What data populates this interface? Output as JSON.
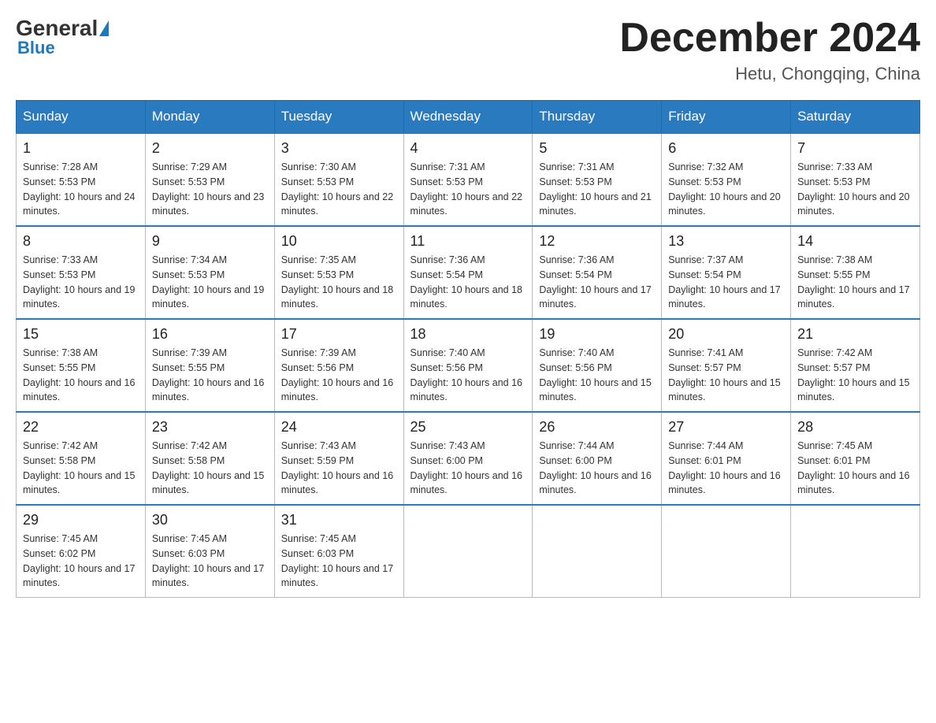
{
  "header": {
    "logo": {
      "general": "General",
      "blue": "Blue"
    },
    "title": "December 2024",
    "location": "Hetu, Chongqing, China"
  },
  "days_of_week": [
    "Sunday",
    "Monday",
    "Tuesday",
    "Wednesday",
    "Thursday",
    "Friday",
    "Saturday"
  ],
  "weeks": [
    [
      {
        "day": "1",
        "sunrise": "7:28 AM",
        "sunset": "5:53 PM",
        "daylight": "10 hours and 24 minutes."
      },
      {
        "day": "2",
        "sunrise": "7:29 AM",
        "sunset": "5:53 PM",
        "daylight": "10 hours and 23 minutes."
      },
      {
        "day": "3",
        "sunrise": "7:30 AM",
        "sunset": "5:53 PM",
        "daylight": "10 hours and 22 minutes."
      },
      {
        "day": "4",
        "sunrise": "7:31 AM",
        "sunset": "5:53 PM",
        "daylight": "10 hours and 22 minutes."
      },
      {
        "day": "5",
        "sunrise": "7:31 AM",
        "sunset": "5:53 PM",
        "daylight": "10 hours and 21 minutes."
      },
      {
        "day": "6",
        "sunrise": "7:32 AM",
        "sunset": "5:53 PM",
        "daylight": "10 hours and 20 minutes."
      },
      {
        "day": "7",
        "sunrise": "7:33 AM",
        "sunset": "5:53 PM",
        "daylight": "10 hours and 20 minutes."
      }
    ],
    [
      {
        "day": "8",
        "sunrise": "7:33 AM",
        "sunset": "5:53 PM",
        "daylight": "10 hours and 19 minutes."
      },
      {
        "day": "9",
        "sunrise": "7:34 AM",
        "sunset": "5:53 PM",
        "daylight": "10 hours and 19 minutes."
      },
      {
        "day": "10",
        "sunrise": "7:35 AM",
        "sunset": "5:53 PM",
        "daylight": "10 hours and 18 minutes."
      },
      {
        "day": "11",
        "sunrise": "7:36 AM",
        "sunset": "5:54 PM",
        "daylight": "10 hours and 18 minutes."
      },
      {
        "day": "12",
        "sunrise": "7:36 AM",
        "sunset": "5:54 PM",
        "daylight": "10 hours and 17 minutes."
      },
      {
        "day": "13",
        "sunrise": "7:37 AM",
        "sunset": "5:54 PM",
        "daylight": "10 hours and 17 minutes."
      },
      {
        "day": "14",
        "sunrise": "7:38 AM",
        "sunset": "5:55 PM",
        "daylight": "10 hours and 17 minutes."
      }
    ],
    [
      {
        "day": "15",
        "sunrise": "7:38 AM",
        "sunset": "5:55 PM",
        "daylight": "10 hours and 16 minutes."
      },
      {
        "day": "16",
        "sunrise": "7:39 AM",
        "sunset": "5:55 PM",
        "daylight": "10 hours and 16 minutes."
      },
      {
        "day": "17",
        "sunrise": "7:39 AM",
        "sunset": "5:56 PM",
        "daylight": "10 hours and 16 minutes."
      },
      {
        "day": "18",
        "sunrise": "7:40 AM",
        "sunset": "5:56 PM",
        "daylight": "10 hours and 16 minutes."
      },
      {
        "day": "19",
        "sunrise": "7:40 AM",
        "sunset": "5:56 PM",
        "daylight": "10 hours and 15 minutes."
      },
      {
        "day": "20",
        "sunrise": "7:41 AM",
        "sunset": "5:57 PM",
        "daylight": "10 hours and 15 minutes."
      },
      {
        "day": "21",
        "sunrise": "7:42 AM",
        "sunset": "5:57 PM",
        "daylight": "10 hours and 15 minutes."
      }
    ],
    [
      {
        "day": "22",
        "sunrise": "7:42 AM",
        "sunset": "5:58 PM",
        "daylight": "10 hours and 15 minutes."
      },
      {
        "day": "23",
        "sunrise": "7:42 AM",
        "sunset": "5:58 PM",
        "daylight": "10 hours and 15 minutes."
      },
      {
        "day": "24",
        "sunrise": "7:43 AM",
        "sunset": "5:59 PM",
        "daylight": "10 hours and 16 minutes."
      },
      {
        "day": "25",
        "sunrise": "7:43 AM",
        "sunset": "6:00 PM",
        "daylight": "10 hours and 16 minutes."
      },
      {
        "day": "26",
        "sunrise": "7:44 AM",
        "sunset": "6:00 PM",
        "daylight": "10 hours and 16 minutes."
      },
      {
        "day": "27",
        "sunrise": "7:44 AM",
        "sunset": "6:01 PM",
        "daylight": "10 hours and 16 minutes."
      },
      {
        "day": "28",
        "sunrise": "7:45 AM",
        "sunset": "6:01 PM",
        "daylight": "10 hours and 16 minutes."
      }
    ],
    [
      {
        "day": "29",
        "sunrise": "7:45 AM",
        "sunset": "6:02 PM",
        "daylight": "10 hours and 17 minutes."
      },
      {
        "day": "30",
        "sunrise": "7:45 AM",
        "sunset": "6:03 PM",
        "daylight": "10 hours and 17 minutes."
      },
      {
        "day": "31",
        "sunrise": "7:45 AM",
        "sunset": "6:03 PM",
        "daylight": "10 hours and 17 minutes."
      },
      null,
      null,
      null,
      null
    ]
  ]
}
